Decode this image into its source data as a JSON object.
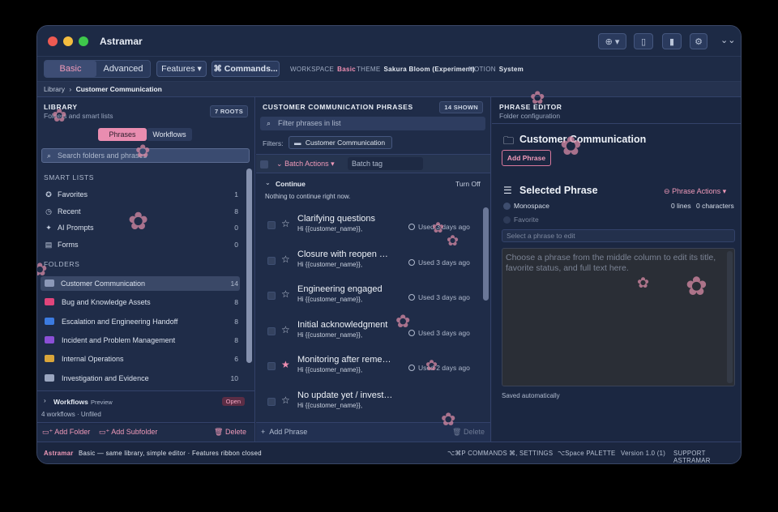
{
  "app": {
    "title": "Astramar"
  },
  "ribbon": {
    "mode_basic": "Basic",
    "mode_advanced": "Advanced",
    "features_label": "Features",
    "commands_label": "⌘ Commands...",
    "workspace_key": "WORKSPACE",
    "workspace_val": "Basic",
    "theme_key": "THEME",
    "theme_val": "Sakura Bloom (Experiment)",
    "motion_key": "MOTION",
    "motion_val": "System"
  },
  "breadcrumb": {
    "root": "Library",
    "sep": "›",
    "current": "Customer Communication"
  },
  "library": {
    "title": "LIBRARY",
    "subtitle": "Folders and smart lists",
    "roots_badge": "7 ROOTS",
    "tab_phrases": "Phrases",
    "tab_workflows": "Workflows",
    "search_placeholder": "Search folders and phrases",
    "smart_lists_title": "SMART LISTS",
    "smart_lists": [
      {
        "label": "Favorites",
        "count": "1",
        "icon": "star-icon"
      },
      {
        "label": "Recent",
        "count": "8",
        "icon": "clock-icon"
      },
      {
        "label": "AI Prompts",
        "count": "0",
        "icon": "sparkle-icon"
      },
      {
        "label": "Forms",
        "count": "0",
        "icon": "form-icon"
      }
    ],
    "folders_title": "FOLDERS",
    "folders": [
      {
        "label": "Customer Communication",
        "count": "14",
        "color": "#8c98b8"
      },
      {
        "label": "Bug and Knowledge Assets",
        "count": "8",
        "color": "#e0457b"
      },
      {
        "label": "Escalation and Engineering Handoff",
        "count": "8",
        "color": "#3c7be0"
      },
      {
        "label": "Incident and Problem Management",
        "count": "8",
        "color": "#8b4fd6"
      },
      {
        "label": "Internal Operations",
        "count": "6",
        "color": "#d9a53a"
      },
      {
        "label": "Investigation and Evidence",
        "count": "10",
        "color": "#9aa6c0"
      }
    ],
    "workflows_label": "Workflows",
    "workflows_tag": "Preview",
    "workflows_open": "Open",
    "workflows_sub": "4 workflows · Unfiled",
    "add_folder": "Add Folder",
    "add_subfolder": "Add Subfolder",
    "delete": "Delete"
  },
  "phrases": {
    "title": "CUSTOMER COMMUNICATION PHRASES",
    "shown_badge": "14 SHOWN",
    "filter_placeholder": "Filter phrases in list",
    "filters_label": "Filters:",
    "filter_chip": "Customer Communication",
    "batch_actions": "Batch Actions",
    "batch_tag_placeholder": "Batch tag",
    "continue_label": "Continue",
    "turn_off": "Turn Off",
    "continue_empty": "Nothing to continue right now.",
    "items": [
      {
        "title": "Clarifying questions",
        "snippet": "Hi {{customer_name}},",
        "used": "Used 3 days ago",
        "favorite": false
      },
      {
        "title": "Closure with reopen guidance",
        "snippet": "Hi {{customer_name}},",
        "used": "Used 3 days ago",
        "favorite": false
      },
      {
        "title": "Engineering engaged",
        "snippet": "Hi {{customer_name}},",
        "used": "Used 3 days ago",
        "favorite": false
      },
      {
        "title": "Initial acknowledgment",
        "snippet": "Hi {{customer_name}},",
        "used": "Used 3 days ago",
        "favorite": false
      },
      {
        "title": "Monitoring after remediation",
        "snippet": "Hi {{customer_name}},",
        "used": "Used 2 days ago",
        "favorite": true
      },
      {
        "title": "No update yet / investigation continuing",
        "snippet": "Hi {{customer_name}},",
        "used": "",
        "favorite": false
      }
    ],
    "add_phrase": "Add Phrase",
    "delete": "Delete"
  },
  "editor": {
    "title": "PHRASE EDITOR",
    "subtitle": "Folder configuration",
    "folder_name": "Customer Communication",
    "add_phrase": "Add Phrase",
    "selected_title": "Selected Phrase",
    "phrase_actions": "Phrase Actions",
    "monospace": "Monospace",
    "favorite": "Favorite",
    "lines": "0 lines",
    "characters": "0 characters",
    "title_placeholder": "Select a phrase to edit",
    "body_placeholder": "Choose a phrase from the middle column to edit its title, favorite status, and full text here.",
    "saved": "Saved automatically"
  },
  "status": {
    "app": "Astramar",
    "desc": "Basic — same library, simple editor · Features ribbon closed",
    "commands": "⌥⌘P COMMANDS",
    "settings": "⌘, SETTINGS",
    "palette": "⌥Space PALETTE",
    "version": "Version 1.0 (1)",
    "support": "SUPPORT ASTRAMAR"
  },
  "colors": {
    "accent": "#f08fb2",
    "window_bg": "#1e2a44"
  }
}
